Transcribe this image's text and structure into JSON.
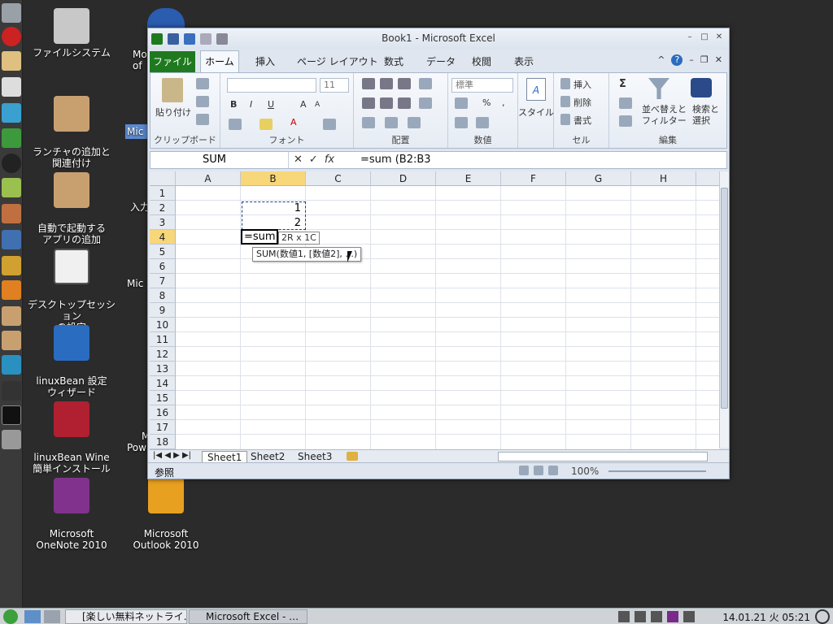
{
  "desktop": {
    "icons": [
      {
        "label": "ファイルシステム"
      },
      {
        "label": "ランチャの追加と\n関連付け"
      },
      {
        "label": "自動で起動する\nアプリの追加"
      },
      {
        "label": "デスクトップセッション\nの設定"
      },
      {
        "label": "linuxBean 設定\nウィザード"
      },
      {
        "label": "linuxBean Wine\n簡単インストール"
      },
      {
        "label": "Microsoft\nOneNote 2010"
      },
      {
        "label": "Microsoft\nOutlook 2010"
      }
    ],
    "partial_labels": [
      "Mo",
      "of",
      "Mic",
      "入力",
      "Mic",
      "M",
      "Pow"
    ]
  },
  "excel": {
    "title": "Book1 - Microsoft Excel",
    "tabs": [
      "ファイル",
      "ホーム",
      "挿入",
      "ページ レイアウト",
      "数式",
      "データ",
      "校閲",
      "表示"
    ],
    "ribbon": {
      "clipboard": {
        "label": "クリップボード",
        "paste": "貼り付け"
      },
      "font": {
        "label": "フォント",
        "size": "11"
      },
      "alignment": {
        "label": "配置"
      },
      "number": {
        "label": "数値",
        "format": "標準"
      },
      "styles": {
        "label": "スタイル"
      },
      "cells": {
        "label": "セル",
        "insert": "挿入",
        "delete": "削除",
        "format": "書式"
      },
      "editing": {
        "label": "編集",
        "sort": "並べ替えと\nフィルター",
        "find": "検索と\n選択"
      }
    },
    "name_box": "SUM",
    "formula": "=sum (B2:B3",
    "columns": [
      "A",
      "B",
      "C",
      "D",
      "E",
      "F",
      "G",
      "H"
    ],
    "rows": [
      "1",
      "2",
      "3",
      "4",
      "5",
      "6",
      "7",
      "8",
      "9",
      "10",
      "11",
      "12",
      "13",
      "14",
      "15",
      "16",
      "17",
      "18"
    ],
    "cells": {
      "B2": "1",
      "B3": "2",
      "B4": "=sum"
    },
    "tooltip_range": "2R x 1C",
    "tooltip_func": "SUM(数値1, [数値2], ...)",
    "sheets": [
      "Sheet1",
      "Sheet2",
      "Sheet3"
    ],
    "status": {
      "mode": "参照",
      "zoom": "100%"
    }
  },
  "taskbar": {
    "items": [
      "[楽しい無料ネットライ…",
      "Microsoft Excel - …"
    ],
    "clock": "14.01.21 火 05:21"
  }
}
